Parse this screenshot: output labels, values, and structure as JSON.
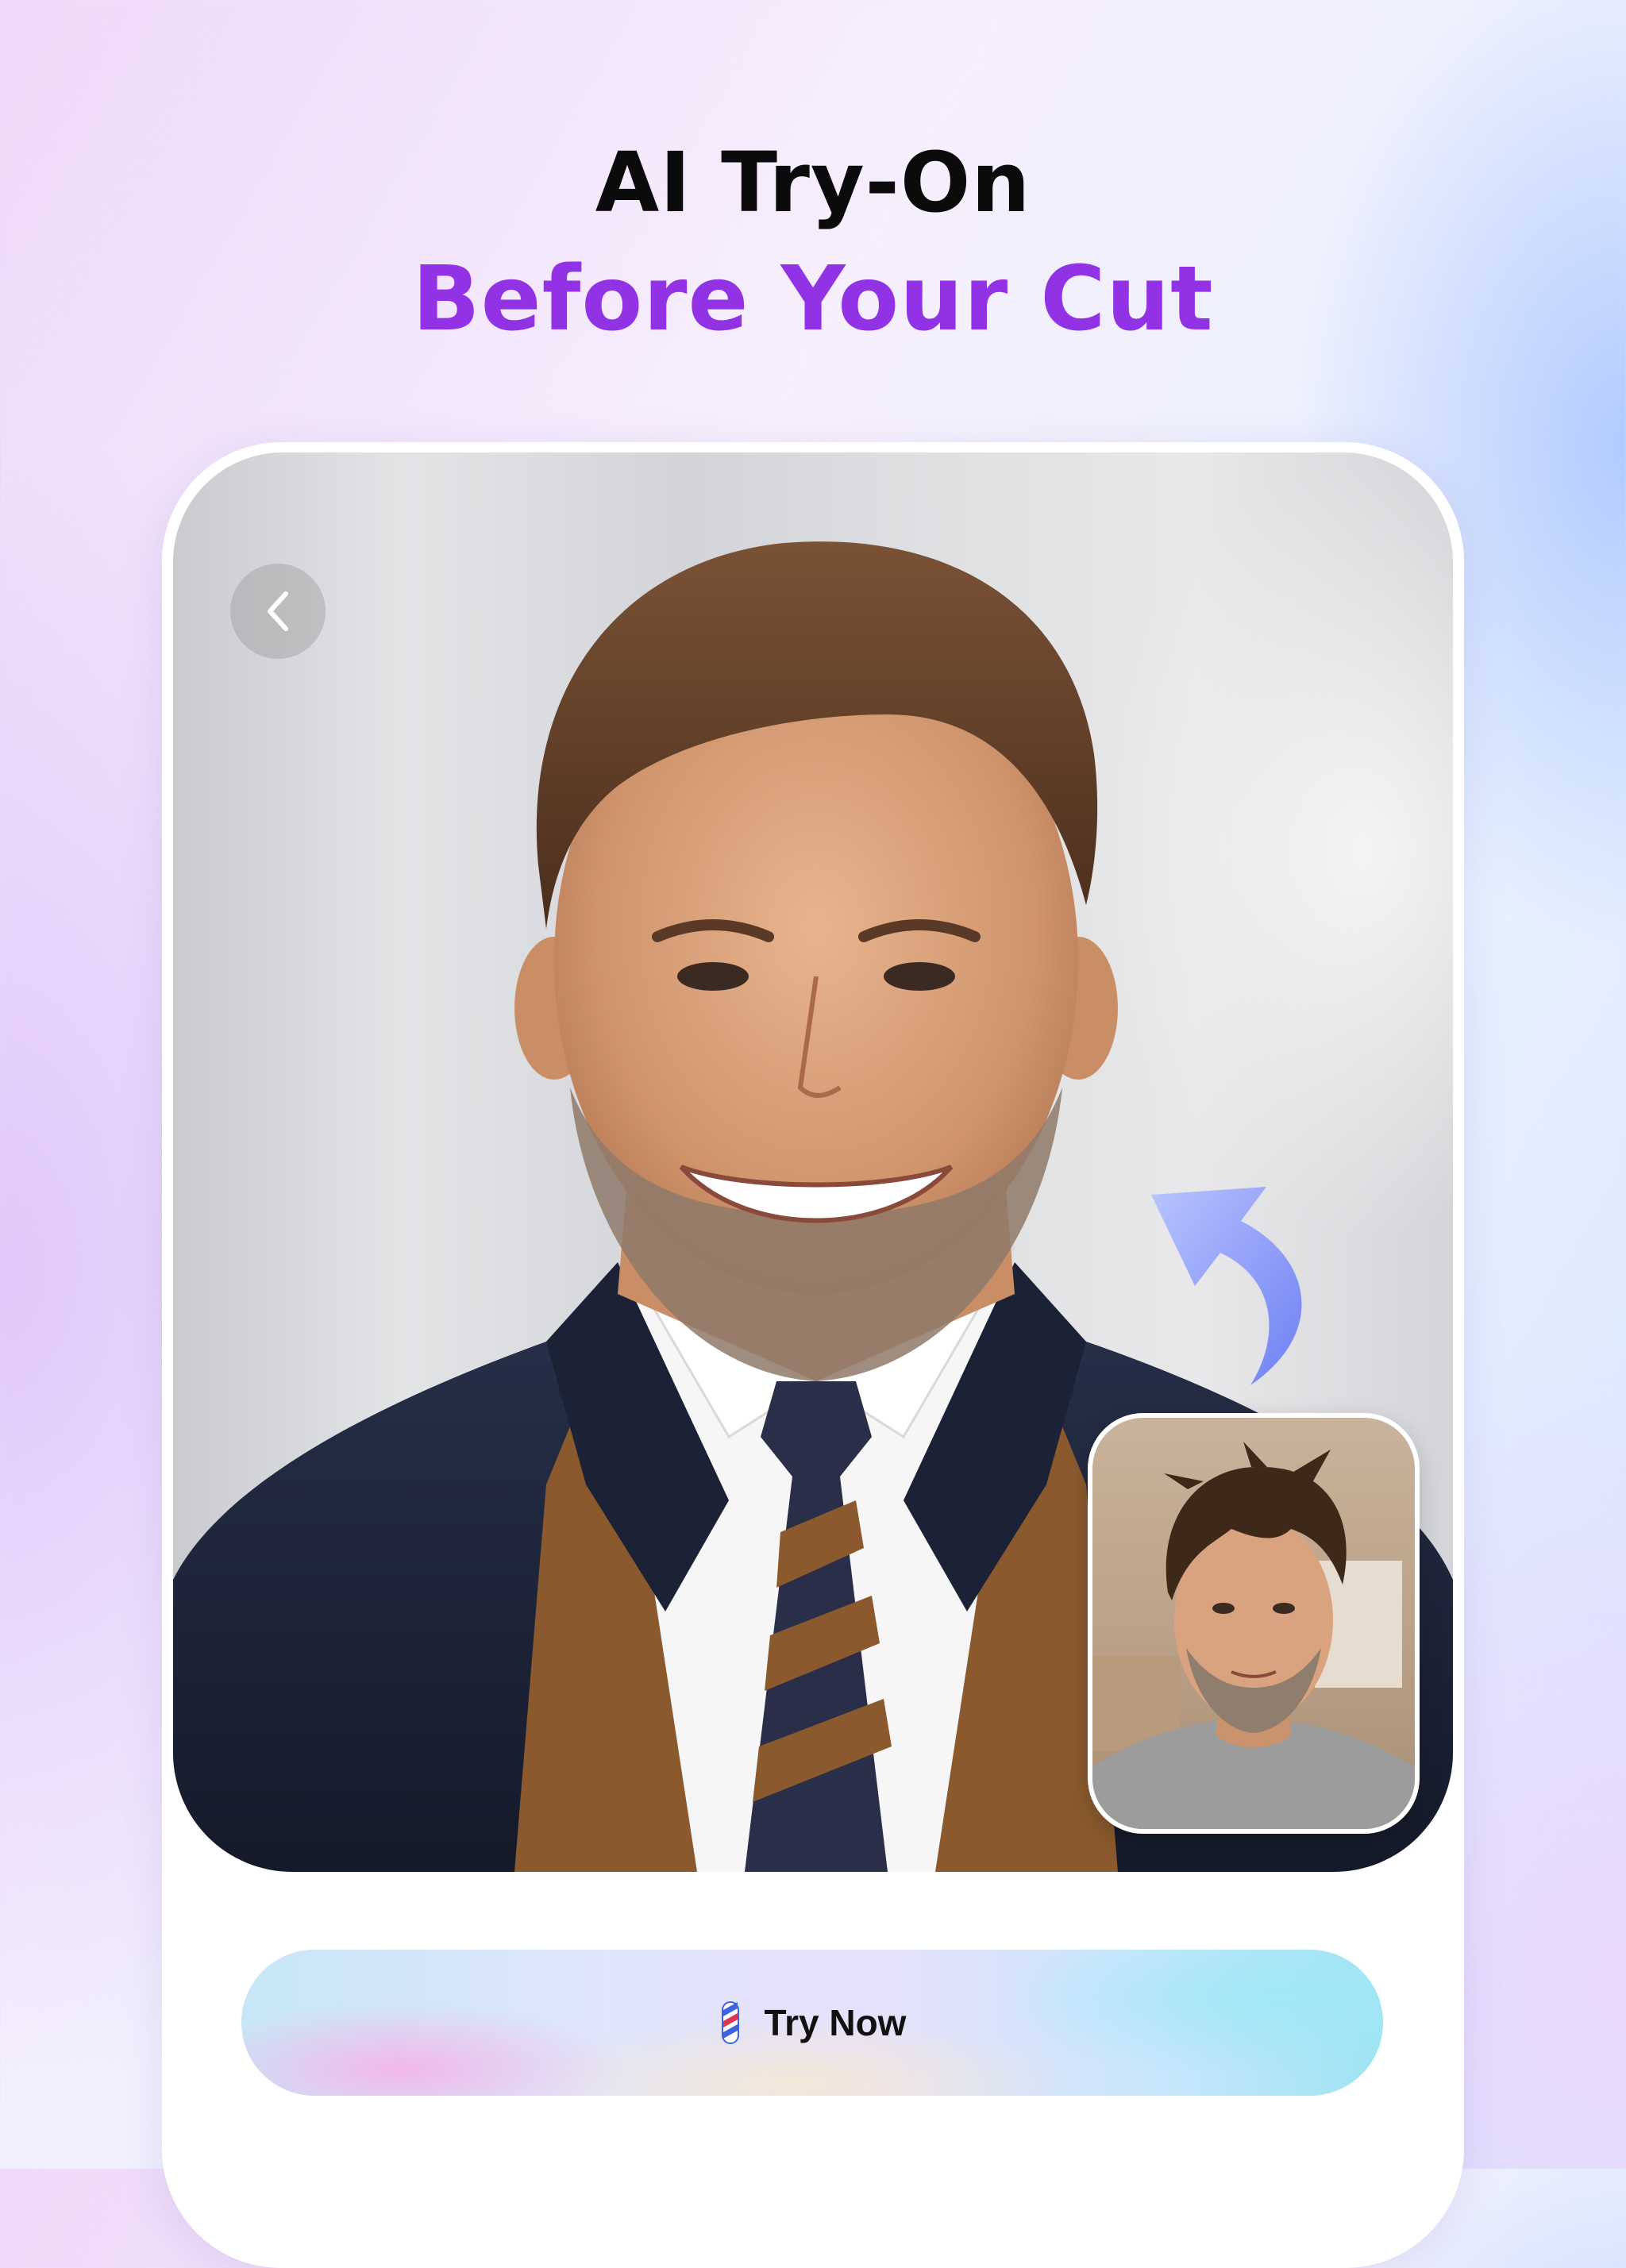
{
  "headline": {
    "line1": "AI Try-On",
    "line2": "Before Your Cut"
  },
  "colors": {
    "accent": "#9232e5",
    "arrow": "#7c8df7",
    "suit": "#1e2336",
    "tie_brown": "#8a5a2e"
  },
  "photo": {
    "subject": "after-photo"
  },
  "thumbnail": {
    "subject": "before-photo"
  },
  "cta": {
    "label": "Try Now",
    "icon": "barber-pole-icon"
  },
  "icons": {
    "back": "chevron-left-icon",
    "arrow": "curved-arrow-icon"
  }
}
